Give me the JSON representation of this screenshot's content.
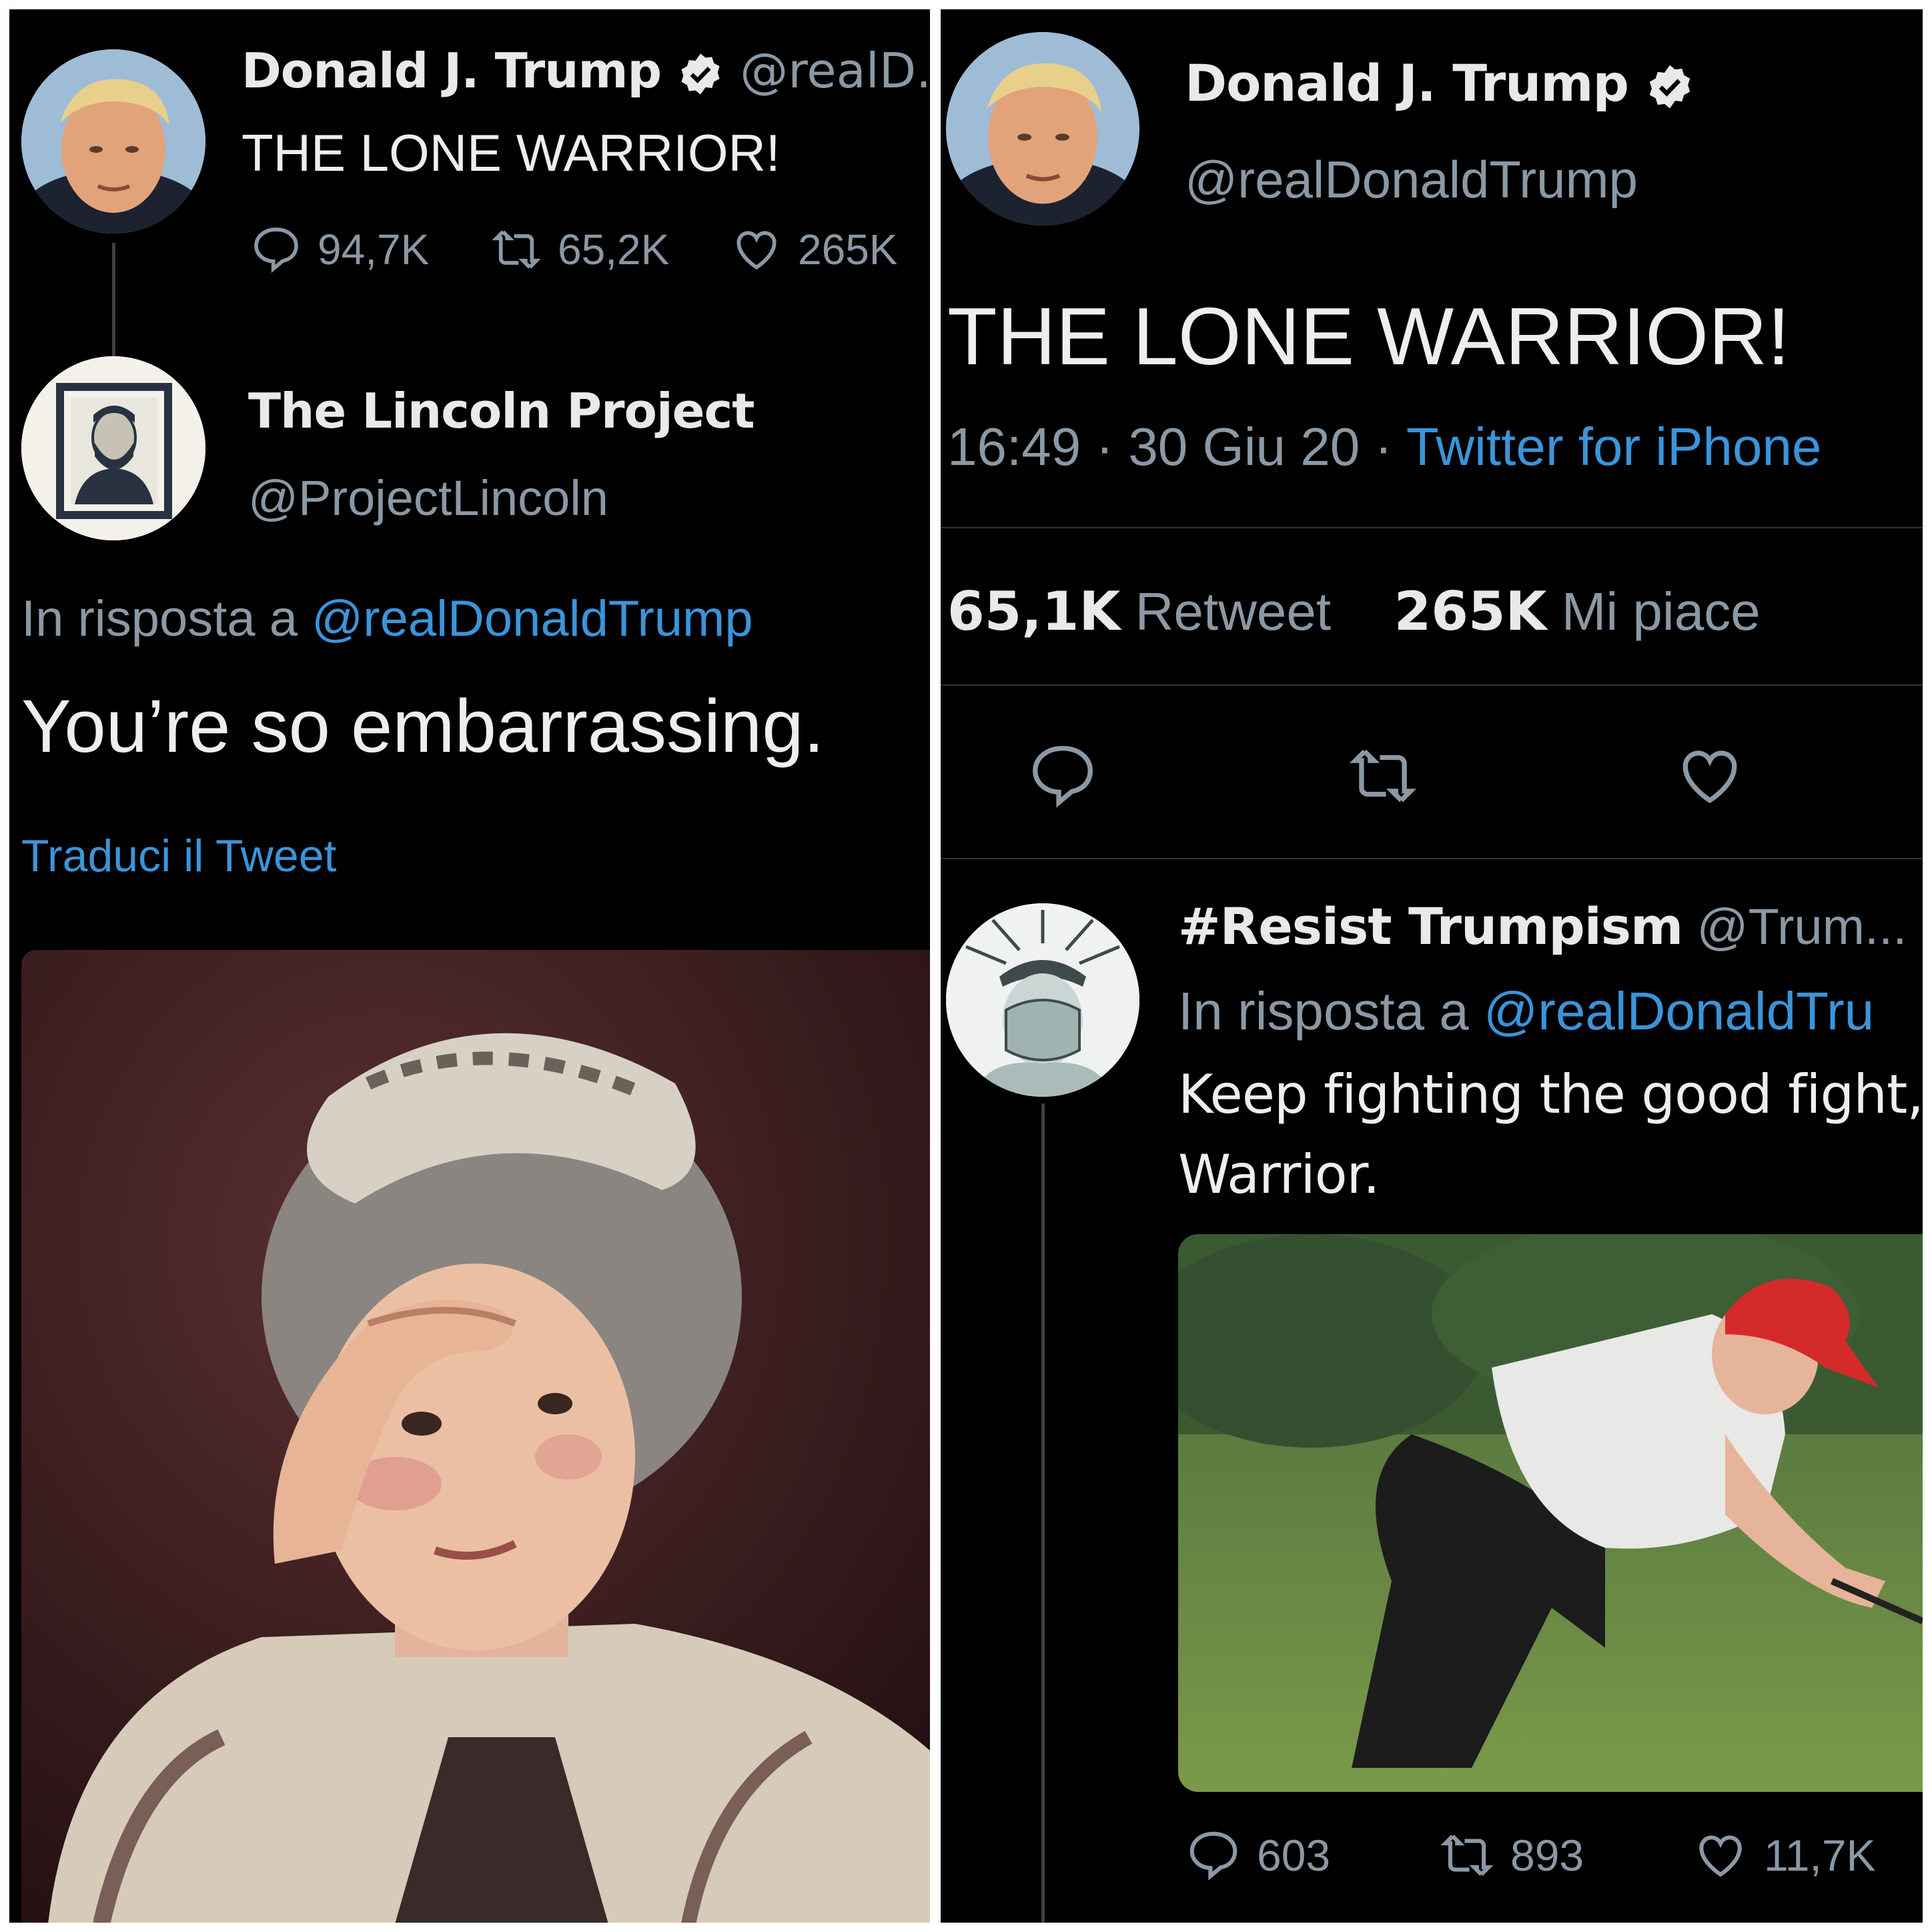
{
  "left": {
    "trump_tweet": {
      "name": "Donald J. Trump",
      "handle": "@realD..",
      "text": "THE LONE WARRIOR!",
      "replies": "94,7K",
      "retweets": "65,2K",
      "likes": "265K"
    },
    "reply": {
      "name": "The Lincoln Project",
      "handle": "@ProjectLincoln",
      "in_reply_prefix": "In risposta a",
      "in_reply_handle": "@realDonaldTrump",
      "text": "You’re so embarrassing.",
      "translate": "Traduci il Tweet"
    }
  },
  "right": {
    "tweet": {
      "name": "Donald J. Trump",
      "handle": "@realDonaldTrump",
      "text": "THE LONE WARRIOR!",
      "time": "16:49",
      "date": "30 Giu 20",
      "source": "Twitter for iPhone",
      "retweets_count": "65,1K",
      "retweets_label": "Retweet",
      "likes_count": "265K",
      "likes_label": "Mi piace"
    },
    "reply": {
      "name": "#Resist Trumpism",
      "handle": "@Trum...",
      "in_reply_prefix": "In risposta a",
      "in_reply_handle": "@realDonaldTru",
      "text_line1": "Keep fighting the good fight,",
      "text_line2": "Warrior.",
      "replies": "603",
      "retweets": "893",
      "likes": "11,7K"
    }
  },
  "icons": [
    "verified-badge-icon",
    "reply-icon",
    "retweet-icon",
    "like-icon"
  ],
  "colors": {
    "background": "#000000",
    "link": "#3b94d9",
    "muted": "#8b98a5",
    "text": "#e7e9ea"
  }
}
